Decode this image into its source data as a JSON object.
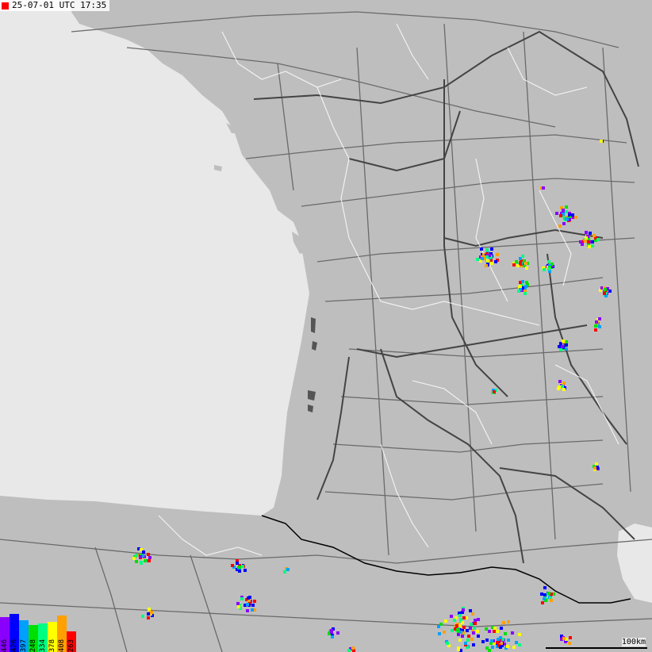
{
  "header": {
    "timestamp": "25-07-01 UTC 17:35",
    "marker_color": "#ff0000"
  },
  "legend": [
    {
      "label": "446",
      "color": "#8a00ff"
    },
    {
      "label": "426",
      "color": "#0000ff"
    },
    {
      "label": "397",
      "color": "#00a0ff"
    },
    {
      "label": "248",
      "color": "#00e000"
    },
    {
      "label": "334",
      "color": "#00ff80"
    },
    {
      "label": "378",
      "color": "#ffff00"
    },
    {
      "label": "408",
      "color": "#ffa000"
    },
    {
      "label": "263",
      "color": "#ff0000"
    }
  ],
  "scale_bar": {
    "label": "100km"
  },
  "colors": {
    "sea": "#e8e8e8",
    "land": "#bebebe",
    "roads": "#5a5a5a",
    "borders": "#ffffff",
    "country_border": "#000000"
  }
}
